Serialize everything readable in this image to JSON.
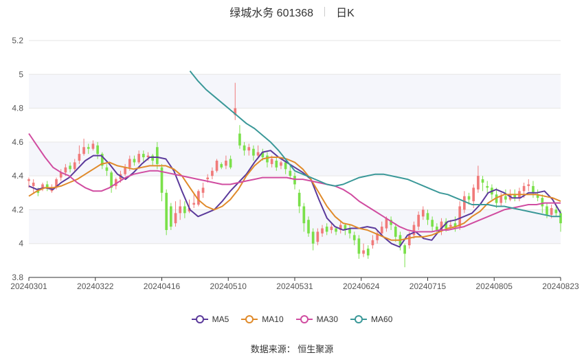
{
  "header": {
    "title": "绿城水务 601368",
    "period": "日K"
  },
  "footer": {
    "source": "数据来源： 恒生聚源"
  },
  "chart_data": {
    "type": "candlestick",
    "ylim": [
      3.8,
      5.2
    ],
    "y_ticks": [
      "5.2",
      "5",
      "4.8",
      "4.6",
      "4.4",
      "4.2",
      "4",
      "3.8"
    ],
    "x_ticks": [
      "20240301",
      "20240322",
      "20240416",
      "20240510",
      "20240531",
      "20240624",
      "20240715",
      "20240805",
      "20240823"
    ],
    "colors": {
      "up": "#f07a7a",
      "down": "#7ae04a",
      "band": "#f5f6fb",
      "grid": "#e6e6e6"
    },
    "series": [
      {
        "name": "MA5",
        "color": "#5b3a9b",
        "values": [
          4.34,
          4.32,
          4.33,
          4.32,
          4.36,
          4.39,
          4.44,
          4.49,
          4.52,
          4.52,
          4.47,
          4.41,
          4.38,
          4.42,
          4.47,
          4.51,
          4.51,
          4.5,
          4.43,
          4.31,
          4.2,
          4.16,
          4.18,
          4.2,
          4.25,
          4.31,
          4.36,
          4.41,
          4.48,
          4.54,
          4.55,
          4.51,
          4.48,
          4.45,
          4.42,
          4.38,
          4.26,
          4.15,
          4.1,
          4.08,
          4.09,
          4.09,
          4.1,
          4.09,
          4.04,
          4.0,
          3.98,
          4.05,
          4.07,
          4.03,
          4.02,
          4.08,
          4.13,
          4.14,
          4.16,
          4.18,
          4.23,
          4.3,
          4.32,
          4.3,
          4.27,
          4.27,
          4.3,
          4.3,
          4.31,
          4.26,
          4.18
        ]
      },
      {
        "name": "MA10",
        "color": "#e08a2a",
        "values": [
          4.28,
          4.31,
          4.33,
          4.33,
          4.34,
          4.36,
          4.38,
          4.41,
          4.44,
          4.47,
          4.48,
          4.46,
          4.45,
          4.44,
          4.45,
          4.46,
          4.46,
          4.46,
          4.44,
          4.4,
          4.33,
          4.26,
          4.22,
          4.2,
          4.22,
          4.26,
          4.32,
          4.4,
          4.46,
          4.5,
          4.51,
          4.51,
          4.5,
          4.48,
          4.44,
          4.38,
          4.3,
          4.22,
          4.16,
          4.12,
          4.11,
          4.09,
          4.08,
          4.06,
          4.04,
          4.02,
          4.02,
          4.03,
          4.04,
          4.04,
          4.05,
          4.07,
          4.09,
          4.1,
          4.12,
          4.16,
          4.19,
          4.24,
          4.27,
          4.29,
          4.29,
          4.29,
          4.29,
          4.29,
          4.28,
          4.27,
          4.25
        ]
      },
      {
        "name": "MA30",
        "color": "#d04ca0",
        "values": [
          4.65,
          4.58,
          4.51,
          4.45,
          4.42,
          4.4,
          4.36,
          4.33,
          4.31,
          4.31,
          4.33,
          4.36,
          4.39,
          4.41,
          4.42,
          4.43,
          4.43,
          4.42,
          4.41,
          4.4,
          4.39,
          4.38,
          4.37,
          4.36,
          4.35,
          4.35,
          4.36,
          4.37,
          4.38,
          4.39,
          4.39,
          4.39,
          4.39,
          4.38,
          4.38,
          4.37,
          4.36,
          4.35,
          4.34,
          4.32,
          4.29,
          4.25,
          4.22,
          4.19,
          4.16,
          4.13,
          4.1,
          4.08,
          4.07,
          4.07,
          4.07,
          4.08,
          4.08,
          4.09,
          4.1,
          4.12,
          4.14,
          4.16,
          4.18,
          4.2,
          4.21,
          4.22,
          4.23,
          4.23,
          4.24,
          4.24,
          4.24
        ]
      },
      {
        "name": "MA60",
        "color": "#3a9898",
        "values": [
          5.02,
          4.96,
          4.91,
          4.87,
          4.83,
          4.79,
          4.75,
          4.71,
          4.68,
          4.64,
          4.6,
          4.55,
          4.49,
          4.43,
          4.41,
          4.39,
          4.37,
          4.35,
          4.34,
          4.35,
          4.37,
          4.39,
          4.4,
          4.41,
          4.41,
          4.4,
          4.39,
          4.38,
          4.36,
          4.34,
          4.32,
          4.3,
          4.29,
          4.27,
          4.25,
          4.23,
          4.23,
          4.23,
          4.22,
          4.22,
          4.21,
          4.2,
          4.19,
          4.18,
          4.17,
          4.16,
          4.16
        ]
      }
    ],
    "candles": [
      [
        4.37,
        4.38,
        4.33,
        4.39
      ],
      [
        4.34,
        4.36,
        4.3,
        4.38
      ],
      [
        4.31,
        4.3,
        4.28,
        4.33
      ],
      [
        4.33,
        4.35,
        4.31,
        4.36
      ],
      [
        4.35,
        4.33,
        4.31,
        4.37
      ],
      [
        4.31,
        4.33,
        4.3,
        4.35
      ],
      [
        4.33,
        4.38,
        4.32,
        4.39
      ],
      [
        4.39,
        4.42,
        4.37,
        4.44
      ],
      [
        4.42,
        4.45,
        4.4,
        4.47
      ],
      [
        4.46,
        4.44,
        4.42,
        4.48
      ],
      [
        4.44,
        4.48,
        4.43,
        4.5
      ],
      [
        4.49,
        4.53,
        4.47,
        4.58
      ],
      [
        4.53,
        4.57,
        4.52,
        4.62
      ],
      [
        4.57,
        4.56,
        4.53,
        4.59
      ],
      [
        4.56,
        4.59,
        4.55,
        4.61
      ],
      [
        4.58,
        4.53,
        4.5,
        4.6
      ],
      [
        4.53,
        4.46,
        4.44,
        4.54
      ],
      [
        4.45,
        4.43,
        4.4,
        4.47
      ],
      [
        4.42,
        4.33,
        4.3,
        4.43
      ],
      [
        4.34,
        4.38,
        4.32,
        4.39
      ],
      [
        4.38,
        4.41,
        4.36,
        4.43
      ],
      [
        4.41,
        4.45,
        4.4,
        4.47
      ],
      [
        4.45,
        4.5,
        4.43,
        4.52
      ],
      [
        4.5,
        4.48,
        4.46,
        4.52
      ],
      [
        4.48,
        4.53,
        4.47,
        4.55
      ],
      [
        4.53,
        4.51,
        4.48,
        4.55
      ],
      [
        4.51,
        4.52,
        4.49,
        4.54
      ],
      [
        4.52,
        4.49,
        4.46,
        4.53
      ],
      [
        4.57,
        4.47,
        4.44,
        4.6
      ],
      [
        4.45,
        4.3,
        4.25,
        4.47
      ],
      [
        4.3,
        4.08,
        4.05,
        4.32
      ],
      [
        4.22,
        4.1,
        4.08,
        4.24
      ],
      [
        4.12,
        4.18,
        4.1,
        4.25
      ],
      [
        4.18,
        4.22,
        4.14,
        4.26
      ],
      [
        4.22,
        4.18,
        4.15,
        4.25
      ],
      [
        4.19,
        4.21,
        4.18,
        4.26
      ],
      [
        4.23,
        4.24,
        4.21,
        4.29
      ],
      [
        4.23,
        4.31,
        4.22,
        4.32
      ],
      [
        4.3,
        4.33,
        4.27,
        4.36
      ],
      [
        4.38,
        4.39,
        4.36,
        4.41
      ],
      [
        4.4,
        4.43,
        4.38,
        4.45
      ],
      [
        4.43,
        4.49,
        4.42,
        4.5
      ],
      [
        4.47,
        4.45,
        4.44,
        4.48
      ],
      [
        4.46,
        4.49,
        4.44,
        4.52
      ],
      [
        4.5,
        4.45,
        4.44,
        4.52
      ],
      [
        4.76,
        4.8,
        4.73,
        4.95
      ],
      [
        4.65,
        4.58,
        4.56,
        4.7
      ],
      [
        4.58,
        4.55,
        4.52,
        4.6
      ],
      [
        4.55,
        4.57,
        4.52,
        4.59
      ],
      [
        4.56,
        4.52,
        4.49,
        4.58
      ],
      [
        4.52,
        4.54,
        4.5,
        4.58
      ],
      [
        4.54,
        4.51,
        4.49,
        4.56
      ],
      [
        4.52,
        4.48,
        4.45,
        4.54
      ],
      [
        4.47,
        4.5,
        4.45,
        4.52
      ],
      [
        4.49,
        4.45,
        4.43,
        4.51
      ],
      [
        4.46,
        4.48,
        4.44,
        4.49
      ],
      [
        4.48,
        4.44,
        4.41,
        4.49
      ],
      [
        4.43,
        4.4,
        4.38,
        4.46
      ],
      [
        4.4,
        4.35,
        4.32,
        4.42
      ],
      [
        4.3,
        4.22,
        4.18,
        4.32
      ],
      [
        4.22,
        4.12,
        4.07,
        4.24
      ],
      [
        4.14,
        4.06,
        4.04,
        4.16
      ],
      [
        4.07,
        4.0,
        3.96,
        4.09
      ],
      [
        4.01,
        4.07,
        3.99,
        4.09
      ],
      [
        4.06,
        4.09,
        4.04,
        4.11
      ],
      [
        4.1,
        4.07,
        4.05,
        4.12
      ],
      [
        4.08,
        4.1,
        4.06,
        4.12
      ],
      [
        4.09,
        4.07,
        4.05,
        4.1
      ],
      [
        4.08,
        4.11,
        4.06,
        4.13
      ],
      [
        4.11,
        4.08,
        4.05,
        4.12
      ],
      [
        4.09,
        4.06,
        4.03,
        4.11
      ],
      [
        4.05,
        4.02,
        3.99,
        4.07
      ],
      [
        4.03,
        3.94,
        3.91,
        4.05
      ],
      [
        3.94,
        3.96,
        3.92,
        4.0
      ],
      [
        3.97,
        3.93,
        3.91,
        3.99
      ],
      [
        3.99,
        4.02,
        3.97,
        4.05
      ],
      [
        4.02,
        4.06,
        4.0,
        4.08
      ],
      [
        4.06,
        4.1,
        4.04,
        4.13
      ],
      [
        4.09,
        4.15,
        4.07,
        4.16
      ],
      [
        4.14,
        4.11,
        4.08,
        4.16
      ],
      [
        4.1,
        4.04,
        4.01,
        4.12
      ],
      [
        4.05,
        3.99,
        3.96,
        4.07
      ],
      [
        3.99,
        3.94,
        3.86,
        4.0
      ],
      [
        3.99,
        4.05,
        3.97,
        4.07
      ],
      [
        4.05,
        4.11,
        4.03,
        4.13
      ],
      [
        4.1,
        4.17,
        4.08,
        4.19
      ],
      [
        4.16,
        4.2,
        4.14,
        4.22
      ],
      [
        4.18,
        4.14,
        4.11,
        4.2
      ],
      [
        4.14,
        4.1,
        4.07,
        4.16
      ],
      [
        4.1,
        4.08,
        4.06,
        4.12
      ],
      [
        4.08,
        4.13,
        4.05,
        4.15
      ],
      [
        4.13,
        4.09,
        4.07,
        4.15
      ],
      [
        4.1,
        4.11,
        4.08,
        4.14
      ],
      [
        4.12,
        4.1,
        4.07,
        4.16
      ],
      [
        4.1,
        4.22,
        4.08,
        4.25
      ],
      [
        4.2,
        4.28,
        4.18,
        4.31
      ],
      [
        4.28,
        4.26,
        4.23,
        4.3
      ],
      [
        4.25,
        4.33,
        4.21,
        4.35
      ],
      [
        4.32,
        4.4,
        4.3,
        4.46
      ],
      [
        4.38,
        4.36,
        4.31,
        4.4
      ],
      [
        4.34,
        4.33,
        4.29,
        4.37
      ],
      [
        4.33,
        4.29,
        4.26,
        4.35
      ],
      [
        4.29,
        4.24,
        4.21,
        4.33
      ],
      [
        4.24,
        4.28,
        4.22,
        4.3
      ],
      [
        4.28,
        4.26,
        4.24,
        4.32
      ],
      [
        4.26,
        4.29,
        4.25,
        4.32
      ],
      [
        4.29,
        4.27,
        4.25,
        4.32
      ],
      [
        4.27,
        4.31,
        4.25,
        4.33
      ],
      [
        4.31,
        4.34,
        4.27,
        4.36
      ],
      [
        4.34,
        4.35,
        4.31,
        4.38
      ],
      [
        4.34,
        4.3,
        4.27,
        4.37
      ],
      [
        4.29,
        4.27,
        4.25,
        4.32
      ],
      [
        4.27,
        4.22,
        4.18,
        4.29
      ],
      [
        4.22,
        4.17,
        4.15,
        4.24
      ],
      [
        4.17,
        4.21,
        4.15,
        4.23
      ],
      [
        4.2,
        4.18,
        4.16,
        4.22
      ],
      [
        4.18,
        4.12,
        4.07,
        4.2
      ]
    ]
  }
}
